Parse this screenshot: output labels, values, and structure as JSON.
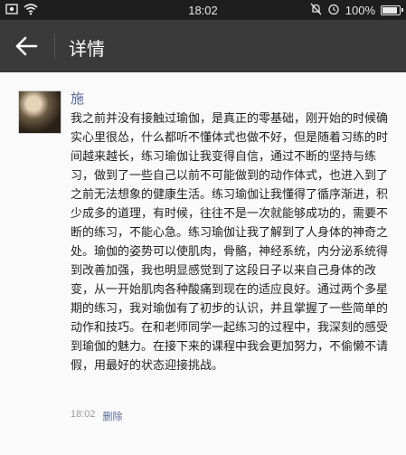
{
  "status_bar": {
    "time": "18:02",
    "battery": "100%"
  },
  "header": {
    "title": "详情"
  },
  "post": {
    "author": "施",
    "body": "我之前并没有接触过瑜伽，是真正的零基础，刚开始的时候确实心里很怂，什么都听不懂体式也做不好，但是随着习练的时间越来越长，练习瑜伽让我变得自信，通过不断的坚持与练习，做到了一些自己以前不可能做到的动作体式，也进入到了之前无法想象的健康生活。练习瑜伽让我懂得了循序渐进，积少成多的道理，有时候，往往不是一次就能够成功的，需要不断的练习，不能心急。练习瑜伽让我了解到了人身体的神奇之处。瑜伽的姿势可以使肌肉，骨骼，神经系统，内分泌系统得到改善加强，我也明显感觉到了这段日子以来自己身体的改变，从一开始肌肉各种酸痛到现在的适应良好。通过两个多星期的练习，我对瑜伽有了初步的认识，并且掌握了一些简单的动作和技巧。在和老师同学一起练习的过程中，我深刻的感受到瑜伽的魅力。在接下来的课程中我会更加努力，不偷懒不请假，用最好的状态迎接挑战。",
    "time": "18:02",
    "delete_label": "删除"
  }
}
